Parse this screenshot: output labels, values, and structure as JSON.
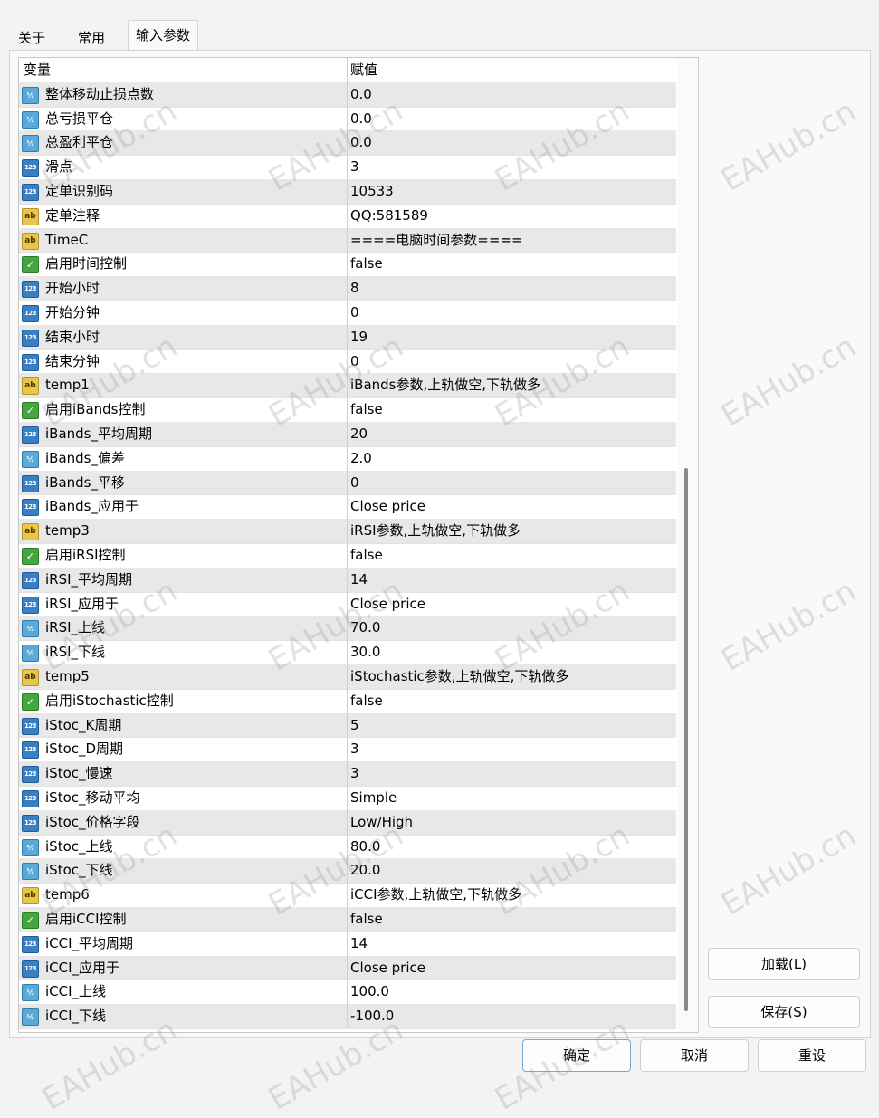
{
  "tabs": [
    "关于",
    "常用",
    "输入参数"
  ],
  "active_tab": 2,
  "table": {
    "columns": [
      "变量",
      "赋值"
    ],
    "rows": [
      {
        "icon": "double",
        "name": "整体移动止损点数",
        "value": "0.0"
      },
      {
        "icon": "double",
        "name": "总亏损平仓",
        "value": "0.0"
      },
      {
        "icon": "double",
        "name": "总盈利平仓",
        "value": "0.0"
      },
      {
        "icon": "int",
        "name": "滑点",
        "value": "3"
      },
      {
        "icon": "int",
        "name": "定单识别码",
        "value": "10533"
      },
      {
        "icon": "string",
        "name": "定单注释",
        "value": "QQ:581589"
      },
      {
        "icon": "string",
        "name": "TimeC",
        "value": "====电脑时间参数===="
      },
      {
        "icon": "bool",
        "name": "启用时间控制",
        "value": "false"
      },
      {
        "icon": "int",
        "name": "开始小时",
        "value": "8"
      },
      {
        "icon": "int",
        "name": "开始分钟",
        "value": "0"
      },
      {
        "icon": "int",
        "name": "结束小时",
        "value": "19"
      },
      {
        "icon": "int",
        "name": "结束分钟",
        "value": "0"
      },
      {
        "icon": "string",
        "name": "temp1",
        "value": "iBands参数,上轨做空,下轨做多"
      },
      {
        "icon": "bool",
        "name": "启用iBands控制",
        "value": "false"
      },
      {
        "icon": "int",
        "name": "iBands_平均周期",
        "value": "20"
      },
      {
        "icon": "double",
        "name": "iBands_偏差",
        "value": "2.0"
      },
      {
        "icon": "int",
        "name": "iBands_平移",
        "value": "0"
      },
      {
        "icon": "int",
        "name": "iBands_应用于",
        "value": "Close price"
      },
      {
        "icon": "string",
        "name": "temp3",
        "value": "iRSI参数,上轨做空,下轨做多"
      },
      {
        "icon": "bool",
        "name": "启用iRSI控制",
        "value": "false"
      },
      {
        "icon": "int",
        "name": "iRSI_平均周期",
        "value": "14"
      },
      {
        "icon": "int",
        "name": "iRSI_应用于",
        "value": "Close price"
      },
      {
        "icon": "double",
        "name": "iRSI_上线",
        "value": "70.0"
      },
      {
        "icon": "double",
        "name": "iRSI_下线",
        "value": "30.0"
      },
      {
        "icon": "string",
        "name": "temp5",
        "value": "iStochastic参数,上轨做空,下轨做多"
      },
      {
        "icon": "bool",
        "name": "启用iStochastic控制",
        "value": "false"
      },
      {
        "icon": "int",
        "name": "iStoc_K周期",
        "value": "5"
      },
      {
        "icon": "int",
        "name": "iStoc_D周期",
        "value": "3"
      },
      {
        "icon": "int",
        "name": "iStoc_慢速",
        "value": "3"
      },
      {
        "icon": "int",
        "name": "iStoc_移动平均",
        "value": "Simple"
      },
      {
        "icon": "int",
        "name": "iStoc_价格字段",
        "value": "Low/High"
      },
      {
        "icon": "double",
        "name": "iStoc_上线",
        "value": "80.0"
      },
      {
        "icon": "double",
        "name": "iStoc_下线",
        "value": "20.0"
      },
      {
        "icon": "string",
        "name": "temp6",
        "value": "iCCI参数,上轨做空,下轨做多"
      },
      {
        "icon": "bool",
        "name": "启用iCCI控制",
        "value": "false"
      },
      {
        "icon": "int",
        "name": "iCCI_平均周期",
        "value": "14"
      },
      {
        "icon": "int",
        "name": "iCCI_应用于",
        "value": "Close price"
      },
      {
        "icon": "double",
        "name": "iCCI_上线",
        "value": "100.0"
      },
      {
        "icon": "double",
        "name": "iCCI_下线",
        "value": "-100.0"
      }
    ]
  },
  "icon_glyphs": {
    "double": "½",
    "int": "123",
    "string": "ab",
    "bool": "✓"
  },
  "side_buttons": {
    "load": "加载(L)",
    "save": "保存(S)"
  },
  "footer_buttons": {
    "ok": "确定",
    "cancel": "取消",
    "reset": "重设"
  },
  "watermark": "EAHub.cn"
}
